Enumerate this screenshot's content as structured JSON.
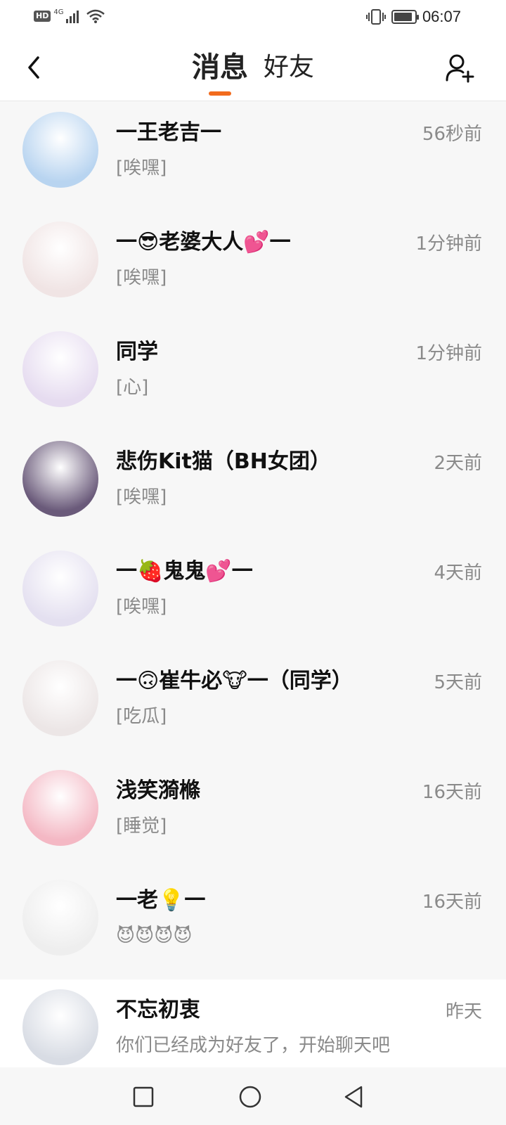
{
  "status_bar": {
    "hd": "HD",
    "network": "4G",
    "time": "06:07",
    "battery_level": 0.9
  },
  "header": {
    "back_icon": "chevron-left-icon",
    "tabs": [
      {
        "label": "消息",
        "active": true
      },
      {
        "label": "好友",
        "active": false
      }
    ],
    "add_icon": "add-friend-icon",
    "accent_color": "#f26b1d"
  },
  "conversations": [
    {
      "name": "一王老吉一",
      "preview": "[唉嘿]",
      "time": "56秒前",
      "avatar_color": "#b8d4f0"
    },
    {
      "name": "一😎老婆大人💕一",
      "preview": "[唉嘿]",
      "time": "1分钟前",
      "avatar_color": "#f0e4e4"
    },
    {
      "name": "同学",
      "preview": "[心]",
      "time": "1分钟前",
      "avatar_color": "#e6dcf0"
    },
    {
      "name": "悲伤Kit猫（BH女团）",
      "preview": "[唉嘿]",
      "time": "2天前",
      "avatar_color": "#6a5a7a"
    },
    {
      "name": "一🍓鬼鬼💕一",
      "preview": "[唉嘿]",
      "time": "4天前",
      "avatar_color": "#e4e0f0"
    },
    {
      "name": "一🙃崔牛必🐮一（同学）",
      "preview": "[吃瓜]",
      "time": "5天前",
      "avatar_color": "#ece6e6"
    },
    {
      "name": "浅笑漪樤",
      "preview": "[睡觉]",
      "time": "16天前",
      "avatar_color": "#f4b8c4"
    },
    {
      "name": "一老💡一",
      "preview": "😈😈😈😈",
      "time": "16天前",
      "avatar_color": "#eeeeee"
    },
    {
      "name": "不忘初衷",
      "preview": "你们已经成为好友了，开始聊天吧",
      "time": "昨天",
      "avatar_color": "#d8dce4"
    }
  ],
  "nav_bar": {
    "icons": [
      "square-icon",
      "circle-icon",
      "triangle-back-icon"
    ]
  }
}
